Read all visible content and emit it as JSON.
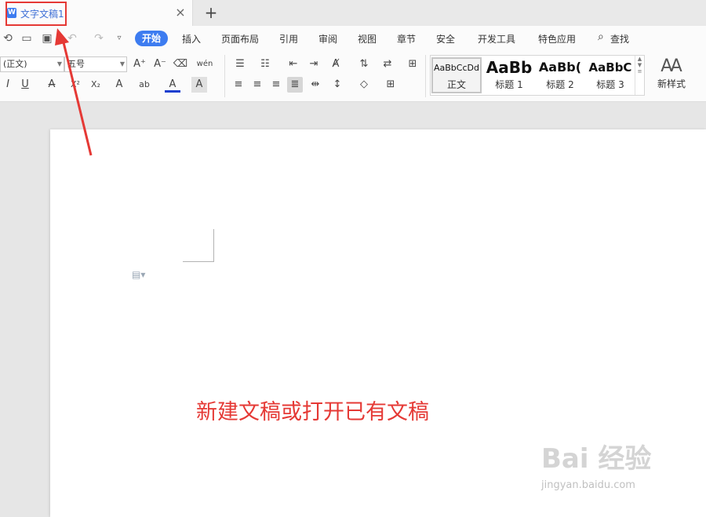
{
  "tab": {
    "doc_icon": "W",
    "title": "文字文稿1",
    "close": "×",
    "new": "+"
  },
  "menu": {
    "items": [
      "开始",
      "插入",
      "页面布局",
      "引用",
      "审阅",
      "视图",
      "章节",
      "安全",
      "开发工具",
      "特色应用",
      "查找"
    ],
    "active": "开始"
  },
  "ribbon": {
    "font_name": "(正文)",
    "font_size": "五号",
    "styles": [
      {
        "sample": "AaBbCcDd",
        "name": "正文"
      },
      {
        "sample": "AaBb",
        "name": "标题 1"
      },
      {
        "sample": "AaBb(",
        "name": "标题 2"
      },
      {
        "sample": "AaBbC",
        "name": "标题 3"
      }
    ],
    "new_style": "新样式"
  },
  "icons": {
    "format_painter": "format-painter-icon",
    "save": "save-icon",
    "font_color_accent": "#1a3fcf",
    "highlight_color": "#3d7cf0",
    "annotation_color": "#e53935"
  },
  "glyphs": {
    "grow_font": "A⁺",
    "shrink_font": "A⁻",
    "clear_format": "⌫",
    "phonetic": "wén",
    "italic": "I",
    "underline": "U",
    "strike": "A",
    "superscript": "X²",
    "subscript": "X₂",
    "text_effect": "A",
    "highlight": "ab",
    "font_color": "A",
    "char_shade": "A"
  },
  "document": {
    "caption": "新建文稿或打开已有文稿"
  },
  "watermark": {
    "brand": "Bai 经验",
    "url": "jingyan.baidu.com"
  }
}
